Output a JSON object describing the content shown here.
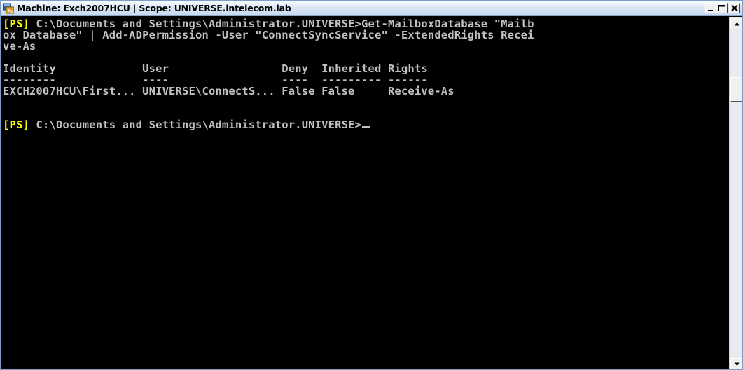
{
  "window": {
    "title": "Machine: Exch2007HCU | Scope: UNIVERSE.intelecom.lab",
    "icon": "powershell-window-icon",
    "controls": [
      "minimize-icon",
      "maximize-icon",
      "close-icon"
    ]
  },
  "console": {
    "command": {
      "prompt_tag": "[PS]",
      "line1_rest": " C:\\Documents and Settings\\Administrator.UNIVERSE>Get-MailboxDatabase \"Mailb",
      "line2": "ox Database\" | Add-ADPermission -User \"ConnectSyncService\" -ExtendedRights Recei",
      "line3": "ve-As"
    },
    "table": {
      "header": "Identity             User                 Deny  Inherited Rights",
      "underline": "--------             ----                 ----  --------- ------",
      "row": "EXCH2007HCU\\First... UNIVERSE\\ConnectS... False False     Receive-As"
    },
    "prompt": {
      "prompt_tag": "[PS]",
      "path": " C:\\Documents and Settings\\Administrator.UNIVERSE>"
    }
  },
  "colors": {
    "background": "#000000",
    "text": "#c0c0c0",
    "prompt_tag": "#ffff00",
    "titlebar": "#dbe7f6"
  }
}
